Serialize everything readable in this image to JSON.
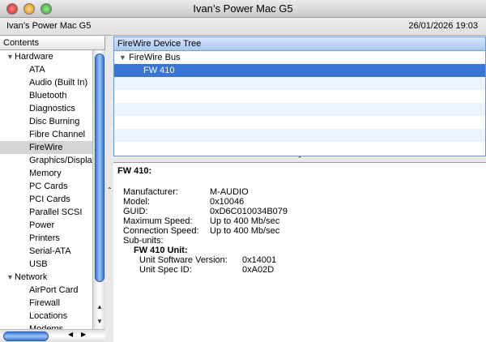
{
  "window": {
    "title": "Ivan’s Power Mac G5"
  },
  "toolbar": {
    "computer_name": "Ivan’s Power Mac G5",
    "date": "26/01/2026 19:03"
  },
  "sidebar": {
    "header": "Contents",
    "items": [
      {
        "label": "Hardware",
        "group": true
      },
      {
        "label": "ATA"
      },
      {
        "label": "Audio (Built In)"
      },
      {
        "label": "Bluetooth"
      },
      {
        "label": "Diagnostics"
      },
      {
        "label": "Disc Burning"
      },
      {
        "label": "Fibre Channel"
      },
      {
        "label": "FireWire",
        "selected": true
      },
      {
        "label": "Graphics/Displays"
      },
      {
        "label": "Memory"
      },
      {
        "label": "PC Cards"
      },
      {
        "label": "PCI Cards"
      },
      {
        "label": "Parallel SCSI"
      },
      {
        "label": "Power"
      },
      {
        "label": "Printers"
      },
      {
        "label": "Serial-ATA"
      },
      {
        "label": "USB"
      },
      {
        "label": "Network",
        "group": true
      },
      {
        "label": "AirPort Card"
      },
      {
        "label": "Firewall"
      },
      {
        "label": "Locations"
      },
      {
        "label": "Modems"
      }
    ]
  },
  "tree": {
    "header": "FireWire Device Tree",
    "bus": "FireWire Bus",
    "device": "FW 410"
  },
  "detail": {
    "title": "FW 410:",
    "fields": [
      {
        "label": "Manufacturer:",
        "value": "M-AUDIO"
      },
      {
        "label": "Model:",
        "value": "0x10046"
      },
      {
        "label": "GUID:",
        "value": "0xD6C010034B079"
      },
      {
        "label": "Maximum Speed:",
        "value": "Up to 400 Mb/sec"
      },
      {
        "label": "Connection Speed:",
        "value": "Up to 400 Mb/sec"
      }
    ],
    "subunits_label": "Sub-units:",
    "unit_title": "FW 410 Unit:",
    "unit_fields": [
      {
        "label": "Unit Software Version:",
        "value": "0x14001"
      },
      {
        "label": "Unit Spec ID:",
        "value": "0xA02D"
      }
    ]
  },
  "colors": {
    "selection": "#3875d7",
    "scroll_thumb": "#3a7ad8"
  }
}
